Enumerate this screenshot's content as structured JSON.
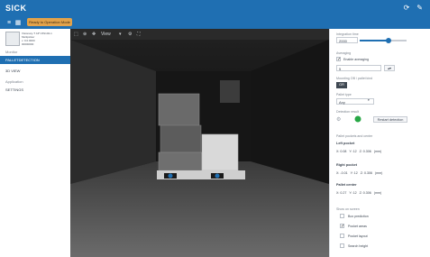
{
  "app": {
    "brand": "SICK",
    "top_icons": [
      "refresh-icon",
      "edit-icon"
    ],
    "toolbar_button": "Ready to Operation Mode"
  },
  "sidebar": {
    "device": {
      "line1": "Visionary-T AP V3S102-1",
      "line2": "Multipicker",
      "line3": "v. 0.0.0000",
      "line4": "00000000"
    },
    "section_monitor": "Monitor",
    "items_top": [
      {
        "label": "PALLETDETECTION",
        "active": true
      },
      {
        "label": "3D VIEW",
        "active": false
      }
    ],
    "section_app": "Application",
    "items_bottom": [
      {
        "label": "SETTINGS",
        "active": false
      }
    ]
  },
  "camera": {
    "toolbar_text": "View"
  },
  "panel": {
    "integration_label": "Integration time",
    "integration_value": "2000",
    "averaging_label": "Averaging",
    "enable_averaging": "Enable averaging",
    "averaging_value": "5",
    "mounting_label": "Mounting OB / pallet kind",
    "mounting_value": "GR",
    "pallet_type_label": "Pallet type",
    "pallet_type_value": "Any",
    "detection_label": "Detection result",
    "restart_detection": "Restart detection",
    "pocket_label": "Pallet pockets and center",
    "left_pocket": {
      "title": "Left pocket",
      "x": "X: 0.08",
      "y": "Y: 12",
      "z": "Z: 0.306",
      "unit": "(mm)"
    },
    "right_pocket": {
      "title": "Right pocket",
      "x": "X: -0.01",
      "y": "Y: 12",
      "z": "Z: 0.306",
      "unit": "(mm)"
    },
    "pallet_center": {
      "title": "Pallet center",
      "x": "X: 0.27",
      "y": "Y: 12",
      "z": "Z: 0.306",
      "unit": "(mm)"
    },
    "show_label": "Show on screen",
    "show_options": [
      {
        "label": "Box prediction",
        "checked": false
      },
      {
        "label": "Pocket areas",
        "checked": true
      },
      {
        "label": "Pocket layout",
        "checked": false
      },
      {
        "label": "Search height",
        "checked": false
      }
    ]
  }
}
